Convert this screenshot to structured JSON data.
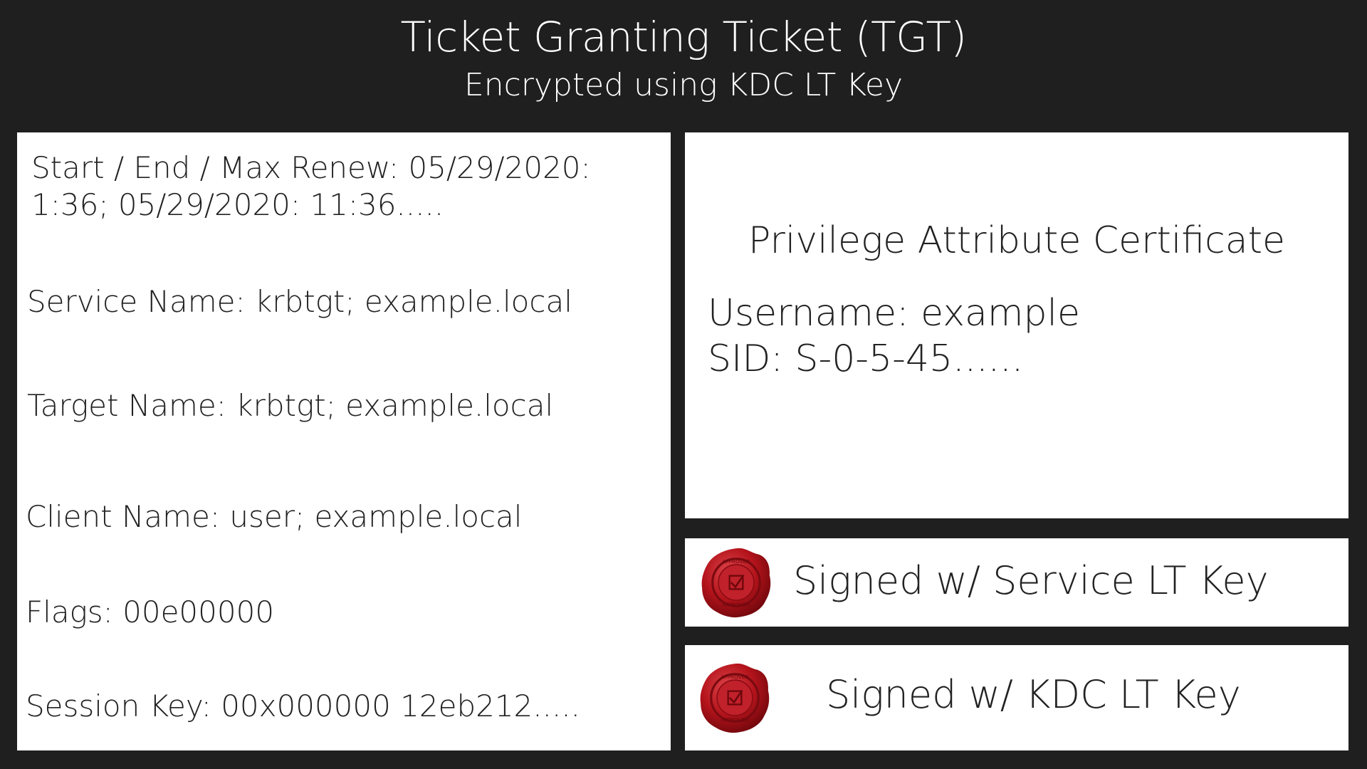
{
  "header": {
    "title": "Ticket Granting Ticket (TGT)",
    "subtitle": "Encrypted using KDC LT Key"
  },
  "ticket_fields": {
    "times": "Start / End / Max Renew: 05/29/2020: 1:36; 05/29/2020: 11:36.....",
    "service_name": "Service Name: krbtgt; example.local",
    "target_name": "Target Name: krbtgt; example.local",
    "client_name": "Client Name: user; example.local",
    "flags": "Flags: 00e00000",
    "session_key": "Session Key: 00x000000 12eb212....."
  },
  "pac": {
    "title": "Privilege Attribute Certificate",
    "username": "Username: example",
    "sid": "SID: S-0-5-45......"
  },
  "signatures": {
    "service": {
      "label": "Signed w/ Service LT Key",
      "seal_text_top": "APPROVED",
      "seal_text_bottom": "APPROVED",
      "icon": "wax-seal-icon"
    },
    "kdc": {
      "label": "Signed w/ KDC LT Key",
      "seal_text_top": "APPROVED",
      "seal_text_bottom": "APPROVED",
      "icon": "wax-seal-icon"
    }
  },
  "colors": {
    "background": "#1f1f1f",
    "panel": "#ffffff",
    "text_dark": "#222222",
    "seal_red": "#b3131b"
  }
}
